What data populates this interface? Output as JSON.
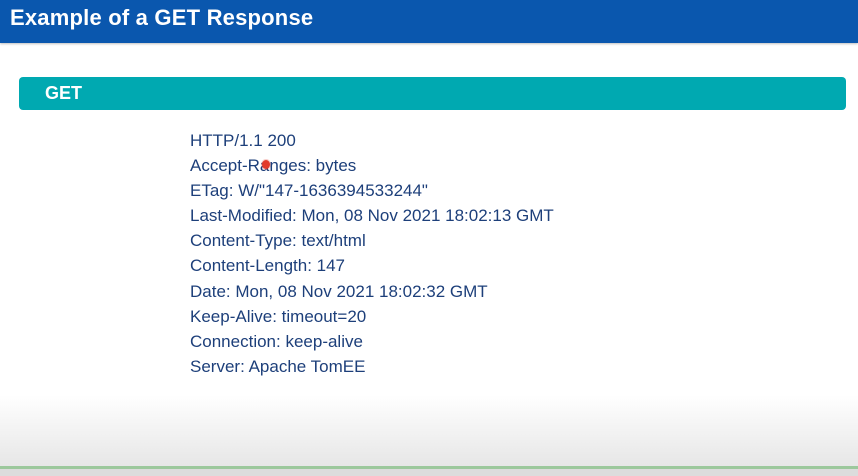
{
  "header": {
    "title": "Example of a GET Response"
  },
  "banner": {
    "label": "GET"
  },
  "response": {
    "lines": [
      "HTTP/1.1 200",
      "Accept-Ranges: bytes",
      "ETag: W/\"147-1636394533244\"",
      "Last-Modified: Mon, 08 Nov 2021 18:02:13 GMT",
      "Content-Type: text/html",
      "Content-Length: 147",
      "Date: Mon, 08 Nov 2021 18:02:32 GMT",
      "Keep-Alive: timeout=20",
      "Connection: keep-alive",
      "Server: Apache TomEE"
    ]
  },
  "colors": {
    "title_bar": "#0a57ae",
    "banner": "#00a9b1",
    "response_text": "#1d3f7a",
    "cursor": "#e23b2c"
  }
}
